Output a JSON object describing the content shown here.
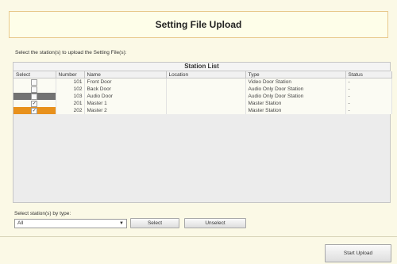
{
  "title": "Setting File Upload",
  "instruction": "Select the station(s) to upload the Setting File(s):",
  "station_list": {
    "title": "Station List",
    "columns": [
      "Select",
      "Number",
      "Name",
      "Location",
      "Type",
      "Status"
    ],
    "rows": [
      {
        "selected": false,
        "number": "101",
        "name": "Front Door",
        "location": "",
        "type": "Video Door Station",
        "status": "-"
      },
      {
        "selected": false,
        "number": "102",
        "name": "Back Door",
        "location": "",
        "type": "Audio Only Door Station",
        "status": "-"
      },
      {
        "selected": false,
        "number": "103",
        "name": "Audio Door",
        "location": "",
        "type": "Audio Only Door Station",
        "status": "-"
      },
      {
        "selected": true,
        "number": "201",
        "name": "Master 1",
        "location": "",
        "type": "Master Station",
        "status": "-"
      },
      {
        "selected": true,
        "number": "202",
        "name": "Master 2",
        "location": "",
        "type": "Master Station",
        "status": "-"
      }
    ]
  },
  "by_type": {
    "label": "Select station(s) by type:",
    "value": "All",
    "select_label": "Select",
    "unselect_label": "Unselect"
  },
  "start_upload_label": "Start Upload",
  "colors": {
    "accent_orange": "#e8911c",
    "title_border": "#e8c98c",
    "background": "#fbf9e6"
  }
}
